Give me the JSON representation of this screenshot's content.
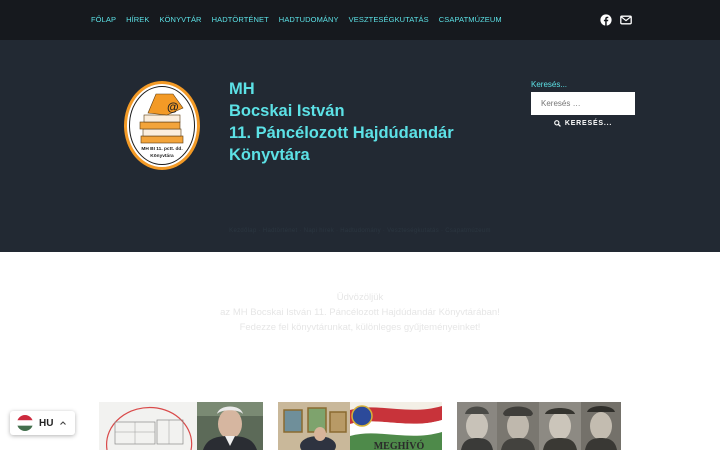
{
  "nav": {
    "items": [
      {
        "label": "FŐLAP"
      },
      {
        "label": "HÍREK"
      },
      {
        "label": "KÖNYVTÁR"
      },
      {
        "label": "HADTÖRTÉNET"
      },
      {
        "label": "HADTUDOMÁNY"
      },
      {
        "label": "VESZTESÉGKUTATÁS"
      },
      {
        "label": "CSAPATMÚZEUM"
      }
    ],
    "social_icons": [
      "facebook-icon",
      "envelope-icon"
    ]
  },
  "hero": {
    "title_lines": [
      "MH",
      "Bocskai István",
      "11. Páncélozott Hajdúdandár",
      "Könyvtára"
    ],
    "logo_text_line1": "MH BI 11. pctt. dd.",
    "logo_text_line2": "Könyvtára"
  },
  "search": {
    "label": "Keresés...",
    "placeholder": "Keresés …",
    "button_label": "KERESÉS..."
  },
  "breadcrumb": "Kezdőlap · Hadtörténet · Napi hírek · Hadtudomány · Veszteségkutatás · Csapatmúzeum",
  "welcome": {
    "line1": "Üdvözöljük",
    "line2": "az MH Bocskai István 11. Páncélozott Hajdúdandár Könyvtárában!",
    "line3": "Fedezze fel könyvtárunkat, különleges gyűjteményeinket!"
  },
  "cards": [
    {
      "image": "floor-plan-and-portrait"
    },
    {
      "image": "meghivo-invitation",
      "overlay_text": "MEGHÍVÓ"
    },
    {
      "image": "soldier-portraits"
    }
  ],
  "language": {
    "code": "HU"
  },
  "colors": {
    "accent": "#5ce1e6",
    "nav_bg": "#16191e",
    "hero_bg": "#222933"
  }
}
